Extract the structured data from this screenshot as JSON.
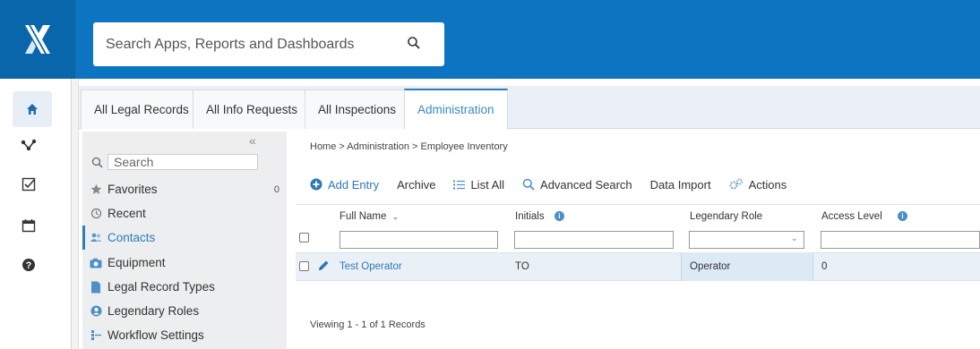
{
  "search": {
    "placeholder": "Search Apps, Reports and Dashboards"
  },
  "tabs": [
    {
      "label": "All Legal Records"
    },
    {
      "label": "All Info Requests"
    },
    {
      "label": "All Inspections"
    },
    {
      "label": "Administration",
      "active": true
    }
  ],
  "sidebar": {
    "search_placeholder": "Search",
    "favorites_count": "0",
    "items": [
      {
        "label": "Favorites",
        "icon": "star-icon"
      },
      {
        "label": "Recent",
        "icon": "history-icon"
      },
      {
        "label": "Contacts",
        "icon": "contacts-icon",
        "active": true
      },
      {
        "label": "Equipment",
        "icon": "camera-icon"
      },
      {
        "label": "Legal Record Types",
        "icon": "document-icon"
      },
      {
        "label": "Legendary Roles",
        "icon": "roles-icon"
      },
      {
        "label": "Workflow Settings",
        "icon": "workflow-icon"
      }
    ]
  },
  "breadcrumb": "Home > Administration > Employee Inventory",
  "toolbar": {
    "add_entry": "Add Entry",
    "archive": "Archive",
    "list_all": "List All",
    "advanced_search": "Advanced Search",
    "data_import": "Data Import",
    "actions": "Actions"
  },
  "grid": {
    "columns": [
      "Full Name",
      "Initials",
      "Legendary Role",
      "Access Level"
    ],
    "rows": [
      {
        "full_name": "Test Operator",
        "initials": "TO",
        "role": "Operator",
        "access_level": "0"
      }
    ]
  },
  "footer": "Viewing 1 - 1 of 1 Records",
  "colors": {
    "brand": "#0c74c0",
    "accent": "#2f7bbb"
  }
}
